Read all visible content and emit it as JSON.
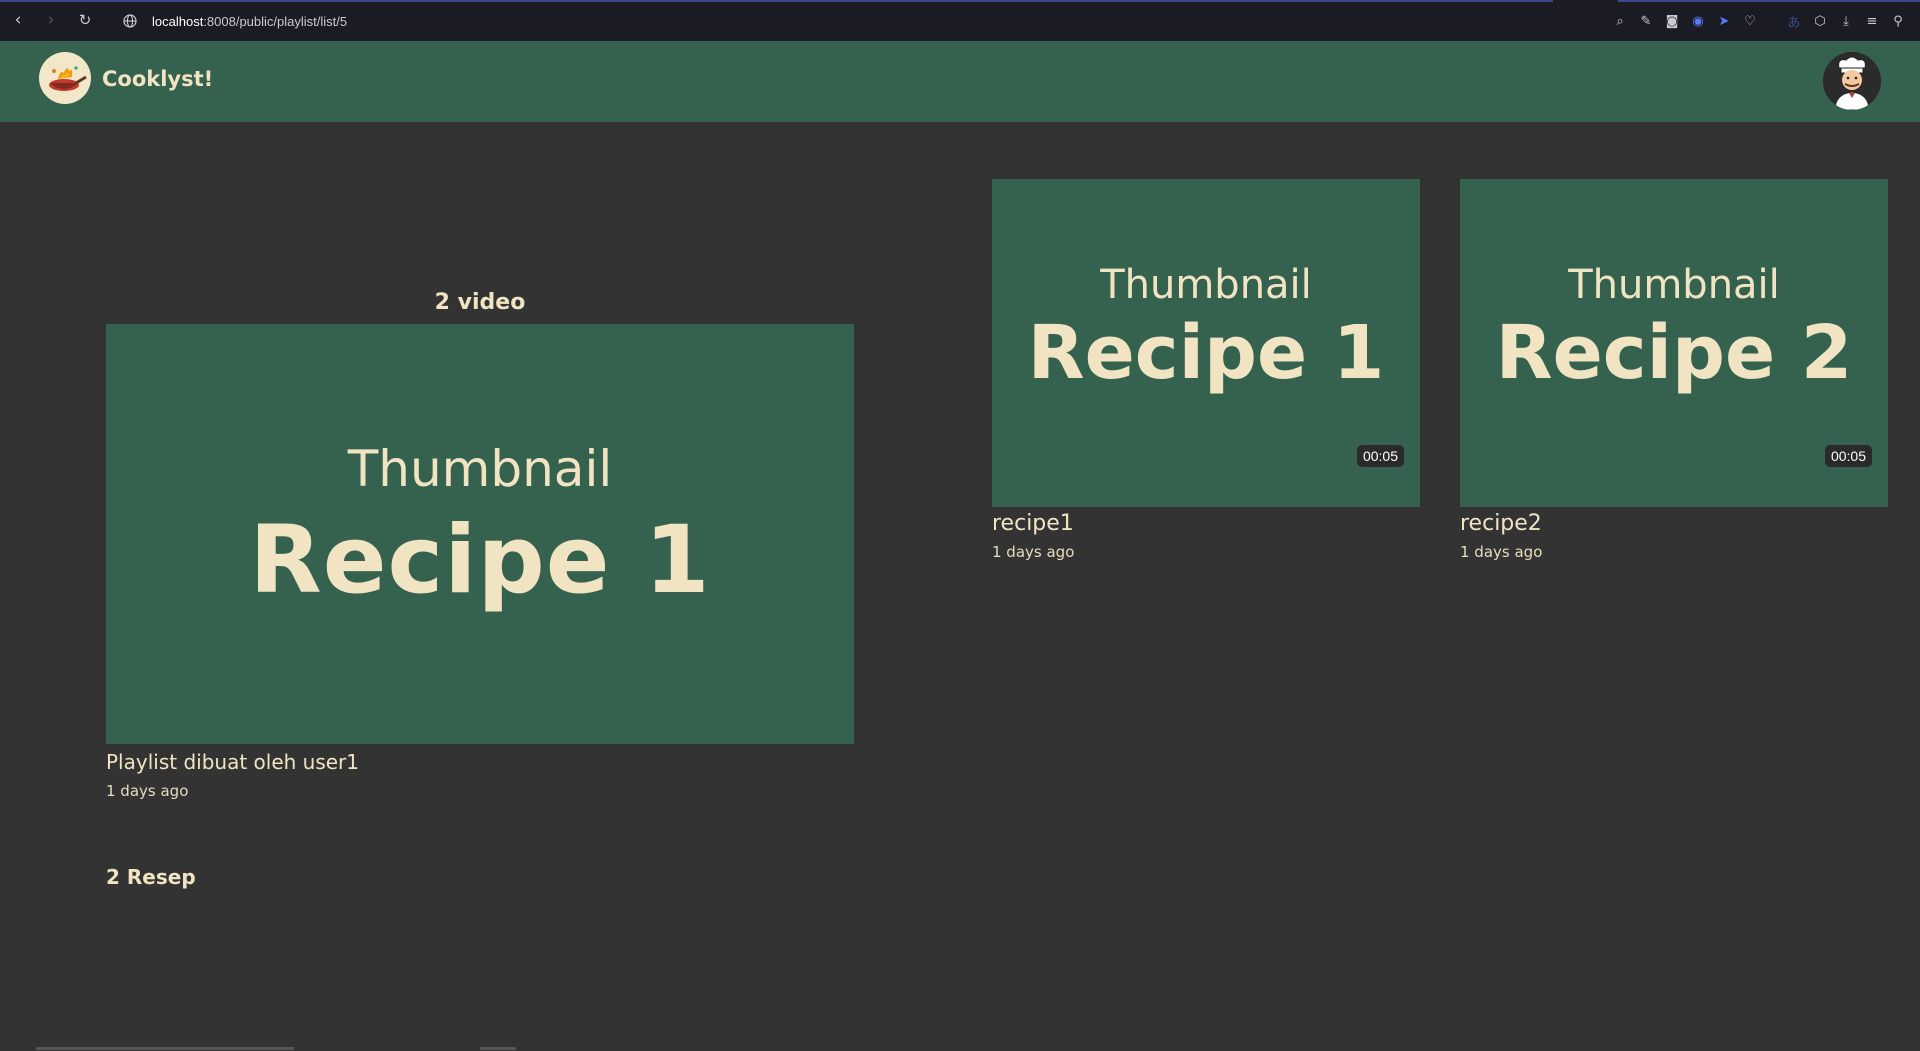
{
  "browser": {
    "url_host": "localhost",
    "url_path": ":8008/public/playlist/list/5",
    "icons": [
      "back-icon",
      "forward-icon",
      "reload-icon",
      "globe-icon",
      "zoom-icon",
      "edit-icon",
      "camera-icon",
      "shield-icon",
      "send-icon",
      "heart-icon",
      "translate-icon",
      "cube-icon",
      "download-icon",
      "menu-icon",
      "profile-icon"
    ]
  },
  "header": {
    "brand": "Cooklyst!",
    "colors": {
      "header_bg": "#35614f",
      "page_bg": "#333333",
      "text": "#f1e4c3"
    }
  },
  "playlist": {
    "video_count": "2 video",
    "thumbnail": {
      "label": "Thumbnail",
      "title": "Recipe 1"
    },
    "owner": "Playlist dibuat oleh user1",
    "time": "1 days ago",
    "recipe_count": "2 Resep"
  },
  "videos": [
    {
      "thumbnail": {
        "label": "Thumbnail",
        "title": "Recipe 1"
      },
      "duration": "00:05",
      "title": "recipe1",
      "time": "1 days ago"
    },
    {
      "thumbnail": {
        "label": "Thumbnail",
        "title": "Recipe 2"
      },
      "duration": "00:05",
      "title": "recipe2",
      "time": "1 days ago"
    }
  ]
}
